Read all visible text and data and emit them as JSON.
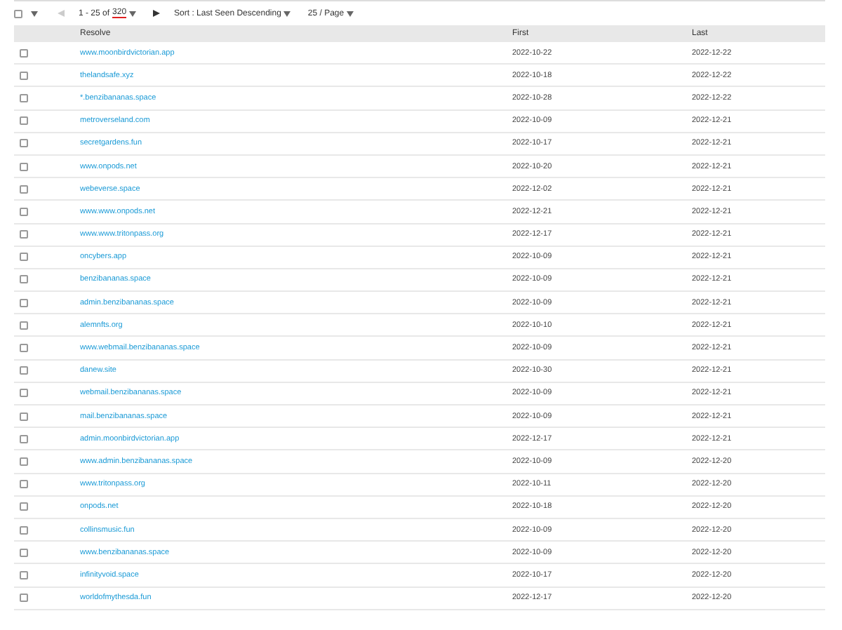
{
  "toolbar": {
    "select_all": {
      "checked": false
    },
    "prev": {
      "disabled": true
    },
    "range": "1 - 25 of ",
    "total": "320",
    "total_underlined": true,
    "next": {
      "disabled": false
    },
    "sort": "Sort : Last Seen Descending",
    "page_size": "25 / Page"
  },
  "table": {
    "columns": [
      "Resolve",
      "First",
      "Last"
    ],
    "rows": [
      {
        "checked": false,
        "resolve": "www.moonbirdvictorian.app",
        "first": "2022-10-22",
        "last": "2022-12-22"
      },
      {
        "checked": false,
        "resolve": "thelandsafe.xyz",
        "first": "2022-10-18",
        "last": "2022-12-22"
      },
      {
        "checked": false,
        "resolve": "*.benzibananas.space",
        "first": "2022-10-28",
        "last": "2022-12-22"
      },
      {
        "checked": false,
        "resolve": "metroverseland.com",
        "first": "2022-10-09",
        "last": "2022-12-21"
      },
      {
        "checked": false,
        "resolve": "secretgardens.fun",
        "first": "2022-10-17",
        "last": "2022-12-21"
      },
      {
        "checked": false,
        "resolve": "www.onpods.net",
        "first": "2022-10-20",
        "last": "2022-12-21"
      },
      {
        "checked": false,
        "resolve": "webeverse.space",
        "first": "2022-12-02",
        "last": "2022-12-21"
      },
      {
        "checked": false,
        "resolve": "www.www.onpods.net",
        "first": "2022-12-21",
        "last": "2022-12-21"
      },
      {
        "checked": false,
        "resolve": "www.www.tritonpass.org",
        "first": "2022-12-17",
        "last": "2022-12-21"
      },
      {
        "checked": false,
        "resolve": "oncybers.app",
        "first": "2022-10-09",
        "last": "2022-12-21"
      },
      {
        "checked": false,
        "resolve": "benzibananas.space",
        "first": "2022-10-09",
        "last": "2022-12-21"
      },
      {
        "checked": false,
        "resolve": "admin.benzibananas.space",
        "first": "2022-10-09",
        "last": "2022-12-21"
      },
      {
        "checked": false,
        "resolve": "alemnfts.org",
        "first": "2022-10-10",
        "last": "2022-12-21"
      },
      {
        "checked": false,
        "resolve": "www.webmail.benzibananas.space",
        "first": "2022-10-09",
        "last": "2022-12-21"
      },
      {
        "checked": false,
        "resolve": "danew.site",
        "first": "2022-10-30",
        "last": "2022-12-21"
      },
      {
        "checked": false,
        "resolve": "webmail.benzibananas.space",
        "first": "2022-10-09",
        "last": "2022-12-21"
      },
      {
        "checked": false,
        "resolve": "mail.benzibananas.space",
        "first": "2022-10-09",
        "last": "2022-12-21"
      },
      {
        "checked": false,
        "resolve": "admin.moonbirdvictorian.app",
        "first": "2022-12-17",
        "last": "2022-12-21"
      },
      {
        "checked": false,
        "resolve": "www.admin.benzibananas.space",
        "first": "2022-10-09",
        "last": "2022-12-20"
      },
      {
        "checked": false,
        "resolve": "www.tritonpass.org",
        "first": "2022-10-11",
        "last": "2022-12-20"
      },
      {
        "checked": false,
        "resolve": "onpods.net",
        "first": "2022-10-18",
        "last": "2022-12-20"
      },
      {
        "checked": false,
        "resolve": "collinsmusic.fun",
        "first": "2022-10-09",
        "last": "2022-12-20"
      },
      {
        "checked": false,
        "resolve": "www.benzibananas.space",
        "first": "2022-10-09",
        "last": "2022-12-20"
      },
      {
        "checked": false,
        "resolve": "infinityvoid.space",
        "first": "2022-10-17",
        "last": "2022-12-20"
      },
      {
        "checked": false,
        "resolve": "worldofmythesda.fun",
        "first": "2022-12-17",
        "last": "2022-12-20"
      }
    ]
  }
}
